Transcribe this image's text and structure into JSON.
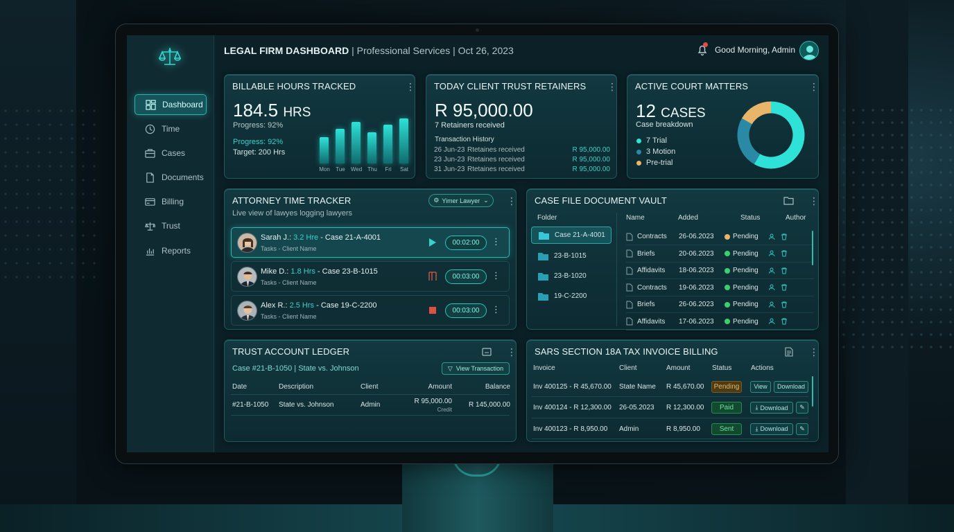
{
  "header": {
    "title": "LEGAL FIRM DASHBOARD",
    "separator": " | ",
    "subtitle": "Professional Services | Oct 26, 2023",
    "greeting": "Good Morning, Admin"
  },
  "sidebar": {
    "items": [
      {
        "label": "Dashboard",
        "icon": "dashboard-icon"
      },
      {
        "label": "Time",
        "icon": "clock-icon"
      },
      {
        "label": "Cases",
        "icon": "briefcase-icon"
      },
      {
        "label": "Documents",
        "icon": "document-icon"
      },
      {
        "label": "Billing",
        "icon": "credit-card-icon"
      },
      {
        "label": "Trust",
        "icon": "scales-icon"
      },
      {
        "label": "Reports",
        "icon": "bar-chart-icon"
      }
    ]
  },
  "billable": {
    "title": "BILLABLE HOURS TRACKED",
    "value": "184.5",
    "unit": "HRS",
    "progress1": "Progress: 92%",
    "progress2": "Progress: 92%",
    "target": "Target: 200 Hrs"
  },
  "chart_data": {
    "type": "bar",
    "categories": [
      "Mon",
      "Tue",
      "Wed",
      "Thu",
      "Fri",
      "Sat"
    ],
    "values": [
      38,
      50,
      60,
      45,
      56,
      65
    ],
    "title": "",
    "xlabel": "",
    "ylabel": ""
  },
  "trust_ret": {
    "title": "TODAY CLIENT TRUST RETAINERS",
    "value": "R 95,000.00",
    "sub": "7 Retainers received",
    "history_title": "Transaction History",
    "rows": [
      {
        "date": "26 Jun-23",
        "desc": "Rtetaines received",
        "amount": "R 95,000.00"
      },
      {
        "date": "23 Jun-23",
        "desc": "Rtetaines received",
        "amount": "R 95,000.00"
      },
      {
        "date": "31 Jun-23",
        "desc": "Rtetaines received",
        "amount": "R 95,000.00"
      }
    ]
  },
  "court": {
    "title": "ACTIVE COURT MATTERS",
    "value": "12",
    "unit": "CASES",
    "sub": "Case breakdown",
    "legend": [
      {
        "label": "7 Trial",
        "color": "#2ee2d8"
      },
      {
        "label": "3 Motion",
        "color": "#2a8aa6"
      },
      {
        "label": "Pre-trial",
        "color": "#e8b56a"
      }
    ],
    "donut": [
      {
        "value": 7,
        "color": "#2ee2d8"
      },
      {
        "value": 3,
        "color": "#2a8aa6"
      },
      {
        "value": 2,
        "color": "#e8b56a"
      }
    ]
  },
  "tracker": {
    "title": "ATTORNEY TIME TRACKER",
    "sub": "Live view of lawyes logging lawyers",
    "filter": "Yimer Lawyer",
    "rows": [
      {
        "name": "Sarah J.: ",
        "hrs": "3.2 Hre",
        "case": " - Case 21-A-4001",
        "task": "Tasks - Client Name",
        "timer": "00:02:00"
      },
      {
        "name": "Mike D.: ",
        "hrs": "1.8 Hrs",
        "case": " - Case 23-B-1015",
        "task": "Tasks - Client Name",
        "timer": "00:03:00"
      },
      {
        "name": "Alex R.: ",
        "hrs": "2.5 Hrs",
        "case": " - Case 19-C-2200",
        "task": "Tasks - Client Name",
        "timer": "00:03:00"
      }
    ]
  },
  "vault": {
    "title": "CASE FILE DOCUMENT VAULT",
    "folder_header": "Folder",
    "folders": [
      "Case 21-A-4001",
      "23-B-1015",
      "23-B-1020",
      "19-C-2200"
    ],
    "headers": [
      "Name",
      "Added",
      "Status",
      "Author"
    ],
    "docs": [
      {
        "name": "Contracts",
        "date": "26-06.2023",
        "status": "Pending",
        "dot": "#e8b56a"
      },
      {
        "name": "Briefs",
        "date": "20-06.2023",
        "status": "Pending",
        "dot": "#3ccf6e"
      },
      {
        "name": "Affidavits",
        "date": "18-06.2023",
        "status": "Pending",
        "dot": "#3ccf6e"
      },
      {
        "name": "Contracts",
        "date": "19-06.2023",
        "status": "Pending",
        "dot": "#3ccf6e"
      },
      {
        "name": "Briefs",
        "date": "26-06.2023",
        "status": "Pending",
        "dot": "#3ccf6e"
      },
      {
        "name": "Affidavits",
        "date": "17-06.2023",
        "status": "Pending",
        "dot": "#3ccf6e"
      }
    ]
  },
  "ledger": {
    "title": "TRUST ACCOUNT LEDGER",
    "case": "Case #21-B-1050 | State vs. Johnson",
    "view_btn": "View Transaction",
    "headers": [
      "Date",
      "Description",
      "Client",
      "Amount",
      "Balance"
    ],
    "row": {
      "date": "#21-B-1050",
      "desc": "State vs. Johnson",
      "client": "Admin",
      "amount": "R 95,000.00",
      "credit": "Credit",
      "balance": "R 145,000.00"
    }
  },
  "billing": {
    "title": "SARS SECTION 18A TAX INVOICE BILLING",
    "headers": [
      "Invoice",
      "Client",
      "Amount",
      "Status",
      "Actions"
    ],
    "rows": [
      {
        "inv": "Inv 400125 - R 45,670.00",
        "client": "State Name",
        "amount": "R 45,670.00",
        "status": "Pending",
        "a1": "View",
        "a2": "Download"
      },
      {
        "inv": "Inv 400124 - R 12,300.00",
        "client": "26-05.2023",
        "amount": "R 12,300.00",
        "status": "Paid",
        "a1": "Download",
        "a2": ""
      },
      {
        "inv": "Inv 400123 - R 8,950.00",
        "client": "Admin",
        "amount": "R 8,950.00",
        "status": "Sent",
        "a1": "Download",
        "a2": ""
      }
    ]
  }
}
